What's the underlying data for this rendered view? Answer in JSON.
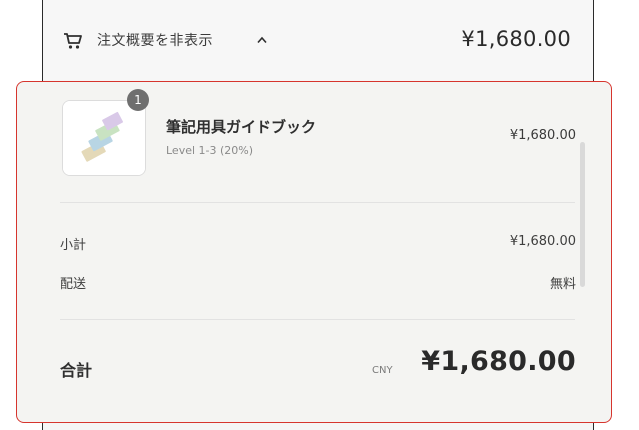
{
  "header": {
    "toggle_label": "注文概要を非表示",
    "total": "¥1,680.00",
    "icons": [
      "cart-icon",
      "chevron-up-icon"
    ]
  },
  "line_item": {
    "quantity": "1",
    "title": "筆記用具ガイドブック",
    "variant": "Level 1-3 (20%)",
    "price": "¥1,680.00"
  },
  "summary": {
    "subtotal_label": "小計",
    "subtotal_value": "¥1,680.00",
    "shipping_label": "配送",
    "shipping_value": "無料"
  },
  "total": {
    "label": "合計",
    "currency": "CNY",
    "value": "¥1,680.00"
  },
  "colors": {
    "highlight_border": "#d6352e",
    "badge": "#6f6f6f",
    "frame_border": "#2b2b2b"
  }
}
